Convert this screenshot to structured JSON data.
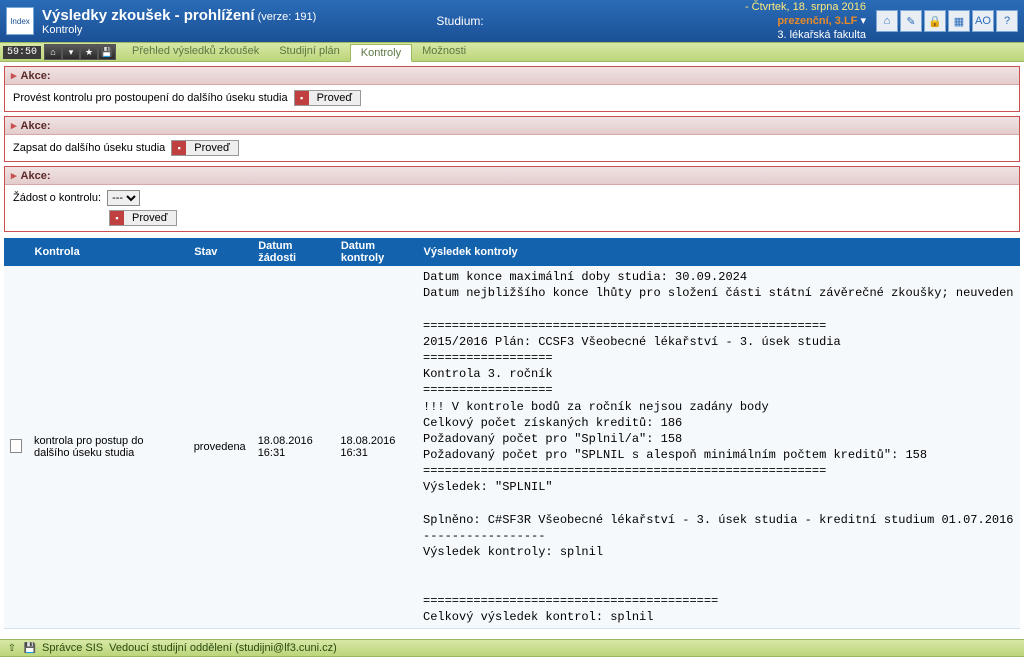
{
  "header": {
    "logo_text": "Index",
    "title": "Výsledky zkoušek - prohlížení",
    "version_label": "(verze: 191)",
    "subtitle": "Kontroly",
    "studium_label": "Studium:",
    "date": "- Čtvrtek, 18. srpna 2016",
    "program": "prezenční, 3.LF",
    "arrow": "▾",
    "faculty": "3. lékařská fakulta",
    "icons": [
      "home-icon",
      "journal-icon",
      "lock-icon",
      "grid-icon",
      "lang-icon",
      "help-icon"
    ],
    "icon_glyphs": [
      "⌂",
      "✎",
      "🔒",
      "▦",
      "AO",
      "?"
    ]
  },
  "nav": {
    "time": "59:50",
    "btns": [
      "home-icon",
      "down-icon",
      "star-icon",
      "save-icon"
    ],
    "btn_glyphs": [
      "⌂",
      "▾",
      "★",
      "💾"
    ],
    "items": [
      {
        "label": "Přehled výsledků zkoušek",
        "active": false
      },
      {
        "label": "Studijní plán",
        "active": false
      },
      {
        "label": "Kontroly",
        "active": true
      },
      {
        "label": "Možnosti",
        "active": false
      }
    ]
  },
  "akce": {
    "heading": "Akce:",
    "sections": [
      {
        "text": "Provést kontrolu pro postoupení do dalšího úseku studia",
        "btn": "Proveď"
      },
      {
        "text": "Zapsat do dalšího úseku studia",
        "btn": "Proveď"
      }
    ],
    "request": {
      "label": "Žádost o kontrolu:",
      "selected": "---",
      "btn": "Proveď"
    }
  },
  "table": {
    "headers": [
      "Kontrola",
      "Stav",
      "Datum žádosti",
      "Datum kontroly",
      "Výsledek kontroly"
    ],
    "row": {
      "kontrola": "kontrola pro postup do dalšího úseku studia",
      "stav": "provedena",
      "datum_zadosti": "18.08.2016 16:31",
      "datum_kontroly": "18.08.2016 16:31",
      "vysledek": "Datum konce maximální doby studia: 30.09.2024\nDatum nejbližšího konce lhůty pro složení části státní závěrečné zkoušky; neuveden\n\n========================================================\n2015/2016 Plán: CCSF3 Všeobecné lékařství - 3. úsek studia\n==================\nKontrola 3. ročník\n==================\n!!! V kontrole bodů za ročník nejsou zadány body\nCelkový počet získaných kreditů: 186\nPožadovaný počet pro \"Splnil/a\": 158\nPožadovaný počet pro \"SPLNIL s alespoň minimálním počtem kreditů\": 158\n========================================================\nVýsledek: \"SPLNIL\"\n\nSplněno: C#SF3R Všeobecné lékařství - 3. úsek studia - kreditní studium 01.07.2016\n-----------------\nVýsledek kontroly: splnil\n\n\n=========================================\nCelkový výsledek kontrol: splnil"
    }
  },
  "footer": {
    "icons": [
      "up-icon",
      "save-icon"
    ],
    "icon_glyphs": [
      "⇧",
      "💾"
    ],
    "admin": "Správce SIS",
    "contact": "Vedoucí studijní oddělení (studijni@lf3.cuni.cz)"
  }
}
